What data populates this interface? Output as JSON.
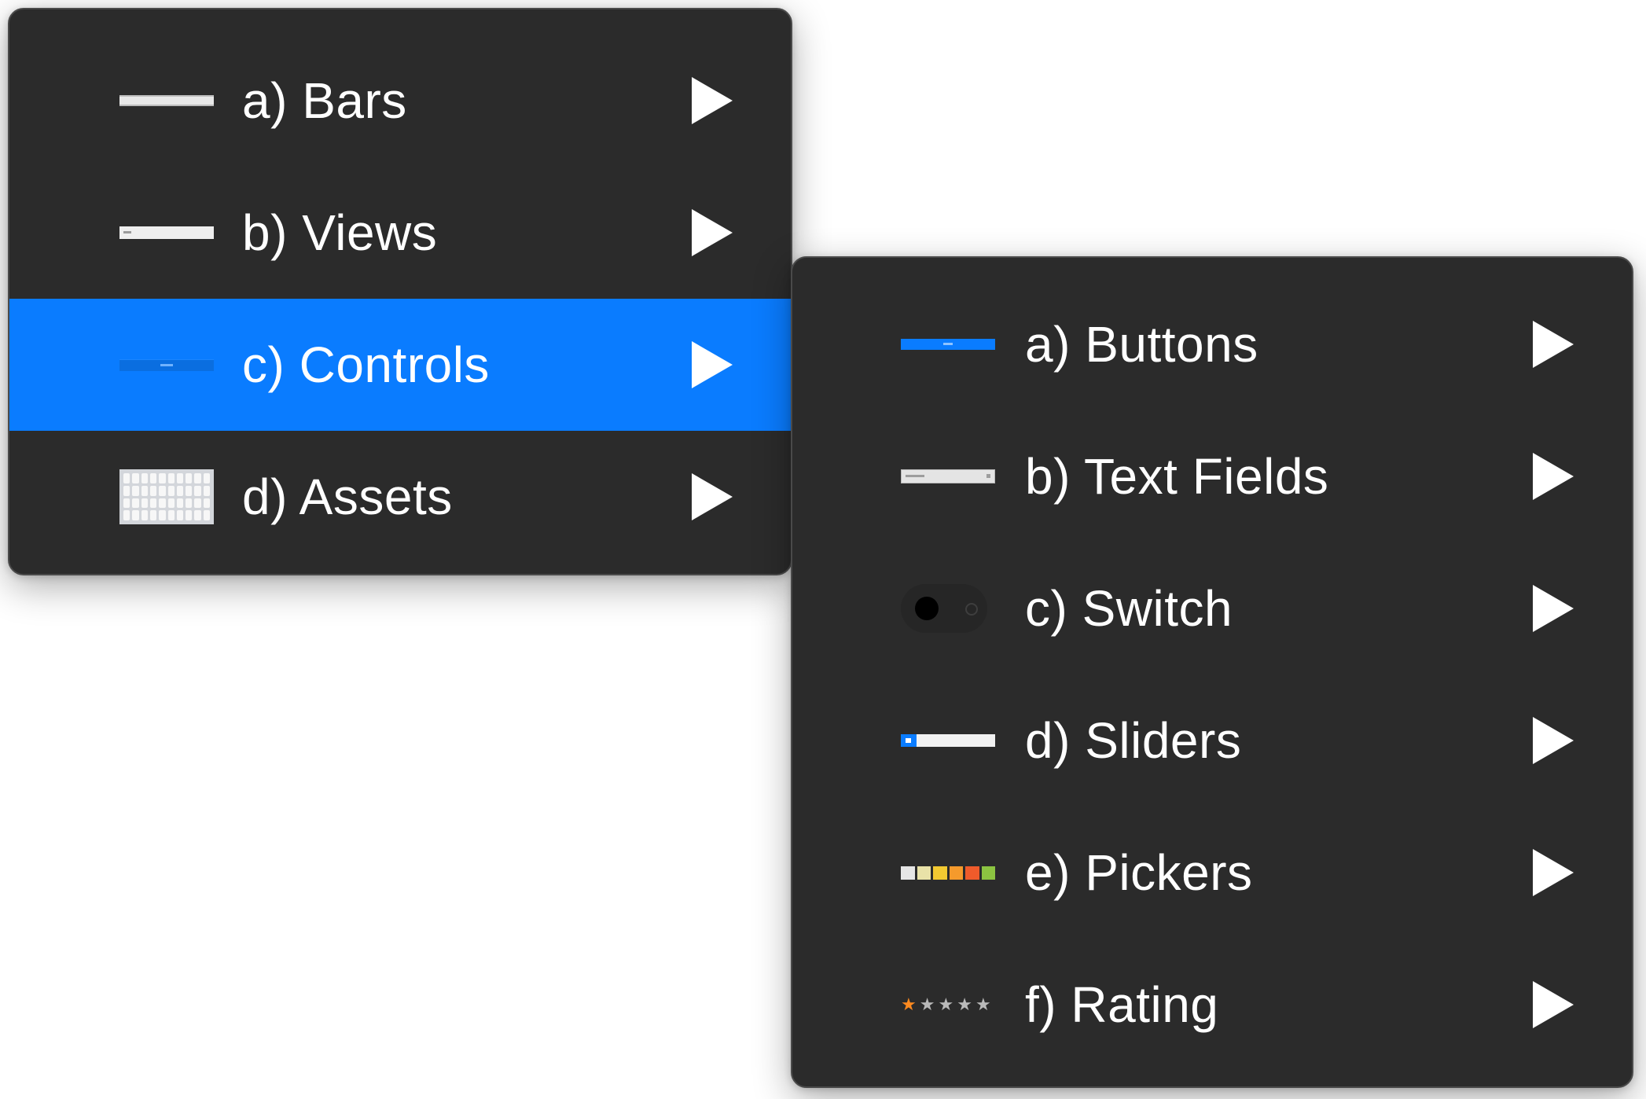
{
  "main_menu": {
    "items": [
      {
        "label": "a) Bars",
        "thumbnail": "bars-thumbnail",
        "highlighted": false
      },
      {
        "label": "b) Views",
        "thumbnail": "views-thumbnail",
        "highlighted": false
      },
      {
        "label": "c) Controls",
        "thumbnail": "controls-thumbnail",
        "highlighted": true
      },
      {
        "label": "d) Assets",
        "thumbnail": "keyboard-thumbnail",
        "highlighted": false
      }
    ],
    "submenu_arrow": "triangle-right-icon"
  },
  "controls_submenu": {
    "items": [
      {
        "label": "a) Buttons",
        "thumbnail": "button-thumbnail"
      },
      {
        "label": "b) Text Fields",
        "thumbnail": "text-field-thumbnail"
      },
      {
        "label": "c) Switch",
        "thumbnail": "switch-thumbnail"
      },
      {
        "label": "d) Sliders",
        "thumbnail": "slider-thumbnail"
      },
      {
        "label": "e) Pickers",
        "thumbnail": "color-swatches-thumbnail"
      },
      {
        "label": "f) Rating",
        "thumbnail": "star-rating-thumbnail"
      }
    ],
    "submenu_arrow": "triangle-right-icon"
  },
  "rating_thumbnail": {
    "value": 1,
    "max": 5
  },
  "colors": {
    "menu_background": "#2b2b2b",
    "highlight": "#0a7cff",
    "text": "#ffffff",
    "picker_swatches": [
      "#e6e6e6",
      "#e9e2a8",
      "#f2c931",
      "#f59a2c",
      "#ef5b2b",
      "#8cc441"
    ],
    "rating_star_active": "#ff8a1f",
    "rating_star_inactive": "#b9b9b9"
  }
}
